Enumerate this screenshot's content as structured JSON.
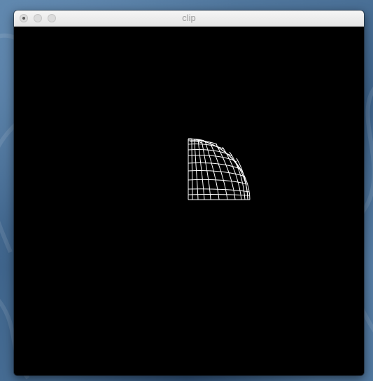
{
  "window": {
    "title": "clip"
  },
  "canvas": {
    "background": "#000000",
    "content": "wireframe-sphere-quadrant",
    "stroke_color": "#ffffff"
  },
  "colors": {
    "desktop": "#44698f",
    "titlebar": "#ececec",
    "title_text": "#9b9b9b"
  }
}
